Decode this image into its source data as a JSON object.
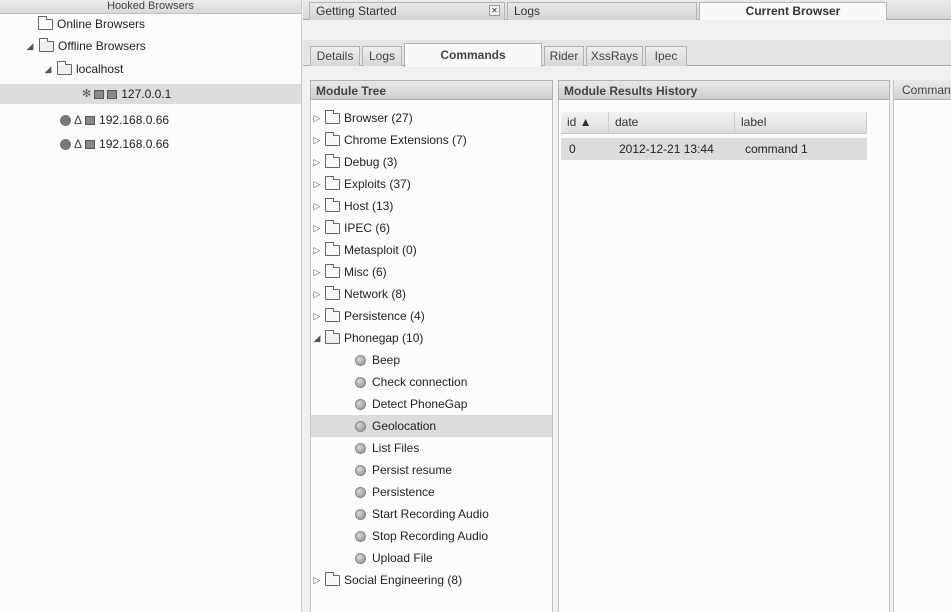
{
  "hooked_browsers": {
    "header": "Hooked Browsers",
    "online": "Online Browsers",
    "offline": "Offline Browsers",
    "host": "localhost",
    "sessions": [
      "127.0.0.1",
      "192.168.0.66",
      "192.168.0.66"
    ]
  },
  "top_tabs": {
    "getting_started": "Getting Started",
    "logs": "Logs",
    "current_browser": "Current Browser"
  },
  "sub_tabs": [
    "Details",
    "Logs",
    "Commands",
    "Rider",
    "XssRays",
    "Ipec"
  ],
  "module_tree": {
    "header": "Module Tree",
    "categories_top": [
      "Browser (27)",
      "Chrome Extensions (7)",
      "Debug (3)",
      "Exploits (37)",
      "Host (13)",
      "IPEC (6)",
      "Metasploit (0)",
      "Misc (6)",
      "Network (8)",
      "Persistence (4)"
    ],
    "open_category": "Phonegap (10)",
    "modules": [
      "Beep",
      "Check connection",
      "Detect PhoneGap",
      "Geolocation",
      "List Files",
      "Persist resume",
      "Persistence",
      "Start Recording Audio",
      "Stop Recording Audio",
      "Upload File"
    ],
    "selected_module": "Geolocation",
    "category_bottom": "Social Engineering (8)"
  },
  "results": {
    "header": "Module Results History",
    "columns": [
      "id ▲",
      "date",
      "label"
    ],
    "rows": [
      {
        "id": "0",
        "date": "2012-12-21 13:44",
        "label": "command 1"
      }
    ]
  },
  "command_panel": {
    "header": "Command"
  }
}
